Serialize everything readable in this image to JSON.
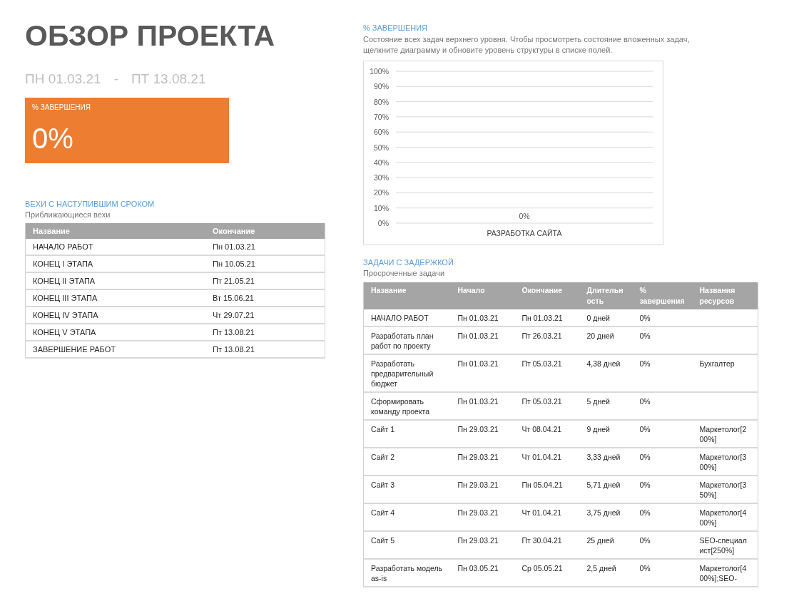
{
  "title": "ОБЗОР ПРОЕКТА",
  "date_range": {
    "start": "ПН 01.03.21",
    "separator": "-",
    "end": "ПТ 13.08.21"
  },
  "completion_card": {
    "label": "% ЗАВЕРШЕНИЯ",
    "value": "0%"
  },
  "milestones": {
    "heading": "ВЕХИ С НАСТУПИВШИМ СРОКОМ",
    "subtitle": "Приближающиеся вехи",
    "columns": [
      "Название",
      "Окончание"
    ],
    "rows": [
      [
        "НАЧАЛО РАБОТ",
        "Пн 01.03.21"
      ],
      [
        "КОНЕЦ I ЭТАПА",
        "Пн 10.05.21"
      ],
      [
        "КОНЕЦ II ЭТАПА",
        "Пт 21.05.21"
      ],
      [
        "КОНЕЦ III ЭТАПА",
        "Вт 15.06.21"
      ],
      [
        "КОНЕЦ IV ЭТАПА",
        "Чт 29.07.21"
      ],
      [
        "КОНЕЦ V ЭТАПА",
        "Пт 13.08.21"
      ],
      [
        "ЗАВЕРШЕНИЕ РАБОТ",
        "Пт 13.08.21"
      ]
    ]
  },
  "completion_chart": {
    "heading": "% ЗАВЕРШЕНИЯ",
    "description": "Состояние всех задач верхнего уровня. Чтобы просмотреть состояние вложенных задач, щелкните диаграмму и обновите уровень структуры в списке полей.",
    "chart_data": {
      "type": "bar",
      "categories": [
        "РАЗРАБОТКА САЙТА"
      ],
      "values": [
        0
      ],
      "ylim": [
        0,
        1
      ],
      "yticks": [
        {
          "value": 0,
          "label": "0%"
        },
        {
          "value": 0.1,
          "label": "10%"
        },
        {
          "value": 0.2,
          "label": "20%"
        },
        {
          "value": 0.3,
          "label": "30%"
        },
        {
          "value": 0.4,
          "label": "40%"
        },
        {
          "value": 0.5,
          "label": "50%"
        },
        {
          "value": 0.6,
          "label": "60%"
        },
        {
          "value": 0.7,
          "label": "70%"
        },
        {
          "value": 0.8,
          "label": "80%"
        },
        {
          "value": 0.9,
          "label": "90%"
        },
        {
          "value": 1,
          "label": "100%"
        }
      ],
      "grid": true,
      "data_labels": true,
      "value_labels": [
        "0%"
      ]
    }
  },
  "late_tasks": {
    "heading": "ЗАДАЧИ С ЗАДЕРЖКОЙ",
    "subtitle": "Просроченные задачи",
    "columns": [
      "Название",
      "Начало",
      "Окончание",
      "Длительность",
      "% завершения",
      "Названия ресурсов"
    ],
    "rows": [
      [
        "НАЧАЛО РАБОТ",
        "Пн 01.03.21",
        "Пн 01.03.21",
        "0 дней",
        "0%",
        ""
      ],
      [
        "Разработать план работ по проекту",
        "Пн 01.03.21",
        "Пт 26.03.21",
        "20 дней",
        "0%",
        ""
      ],
      [
        "Разработать предварительный бюджет",
        "Пн 01.03.21",
        "Пт 05.03.21",
        "4,38 дней",
        "0%",
        "Бухгалтер"
      ],
      [
        "Сформировать команду проекта",
        "Пн 01.03.21",
        "Пт 05.03.21",
        "5 дней",
        "0%",
        ""
      ],
      [
        "Сайт 1",
        "Пн 29.03.21",
        "Чт 08.04.21",
        "9 дней",
        "0%",
        "Маркетолог[200%]"
      ],
      [
        "Сайт 2",
        "Пн 29.03.21",
        "Чт 01.04.21",
        "3,33 дней",
        "0%",
        "Маркетолог[300%]"
      ],
      [
        "Сайт 3",
        "Пн 29.03.21",
        "Пн 05.04.21",
        "5,71 дней",
        "0%",
        "Маркетолог[350%]"
      ],
      [
        "Сайт 4",
        "Пн 29.03.21",
        "Чт 01.04.21",
        "3,75 дней",
        "0%",
        "Маркетолог[400%]"
      ],
      [
        "Сайт 5",
        "Пн 29.03.21",
        "Пт 30.04.21",
        "25 дней",
        "0%",
        "SEO-специалист[250%]"
      ],
      [
        "Разработать модель as-is",
        "Пн 03.05.21",
        "Ср 05.05.21",
        "2,5 дней",
        "0%",
        "Маркетолог[400%];SEO-"
      ]
    ]
  }
}
